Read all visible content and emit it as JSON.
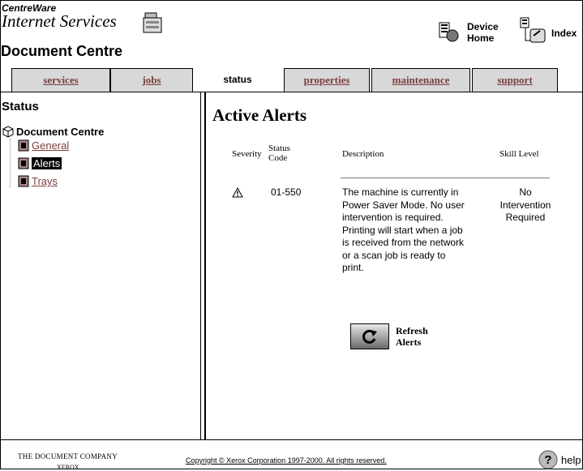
{
  "header": {
    "brand_line1": "CentreWare",
    "brand_line2": "Internet Services",
    "device_title": "Document Centre",
    "nav": [
      {
        "line1": "Device",
        "line2": "Home"
      },
      {
        "label": "Index"
      }
    ]
  },
  "tabs": [
    {
      "label": "services"
    },
    {
      "label": "jobs"
    },
    {
      "label": "status"
    },
    {
      "label": "properties"
    },
    {
      "label": "maintenance"
    },
    {
      "label": "support"
    }
  ],
  "sidebar": {
    "title": "Status",
    "root": "Document Centre",
    "items": [
      {
        "label": "General"
      },
      {
        "label": "Alerts"
      },
      {
        "label": "Trays"
      }
    ]
  },
  "main": {
    "title": "Active Alerts",
    "columns": {
      "severity": "Severity",
      "status_code_1": "Status",
      "status_code_2": "Code",
      "description": "Description",
      "skill": "Skill Level"
    },
    "alerts": [
      {
        "severity_icon": "warning-icon",
        "status_code": "01-550",
        "description_lines": [
          "The machine is currently in",
          "Power Saver Mode. No user",
          "intervention is required.",
          "Printing will start when a job",
          "is received from the network",
          "or a scan job is ready to",
          "print."
        ],
        "skill_lines": [
          "No",
          "Intervention",
          "Required"
        ]
      }
    ],
    "refresh_line1": "Refresh",
    "refresh_line2": "Alerts"
  },
  "footer": {
    "company_line1": "THE DOCUMENT COMPANY",
    "company_line2": "XEROX",
    "copyright": "Copyright © Xerox Corporation 1997-2000. All rights reserved.",
    "help": "help"
  }
}
